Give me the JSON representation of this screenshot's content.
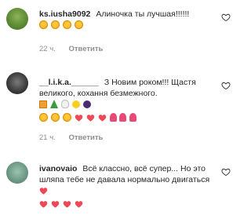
{
  "comments": [
    {
      "username": "ks.iusha9092",
      "text": "Алиночка ты лучшая!!!!!!",
      "emoji": [
        "smiling-face-with-heart-eyes",
        "smiling-face-with-heart-eyes",
        "smiling-face-with-heart-eyes",
        "smiling-face-with-heart-eyes"
      ],
      "time": "22 ч.",
      "reply_label": "Ответить"
    },
    {
      "username": "__l.i.k.a.______",
      "text": "З Новим роком!!! Щастя великого, кохання безмежного.",
      "emoji": [
        "gift",
        "christmas-tree",
        "snowman",
        "sparkles",
        "bug",
        "heart-eyes",
        "smiling-face",
        "smiling-face",
        "red-heart",
        "red-heart",
        "red-heart",
        "tulip",
        "tulip",
        "tulip"
      ],
      "time": "21 ч.",
      "reply_label": "Ответить"
    },
    {
      "username": "ivanovaio",
      "text": "Всё классно, всё супер... Но это шляпа тебе не давала нормально двигаться",
      "emoji": [
        "red-heart",
        "red-heart",
        "red-heart",
        "red-heart",
        "red-heart"
      ],
      "time": "",
      "reply_label": ""
    }
  ],
  "colors": {
    "text": "#262626",
    "meta": "#8e8e8e",
    "heart_red": "#ed4956"
  }
}
